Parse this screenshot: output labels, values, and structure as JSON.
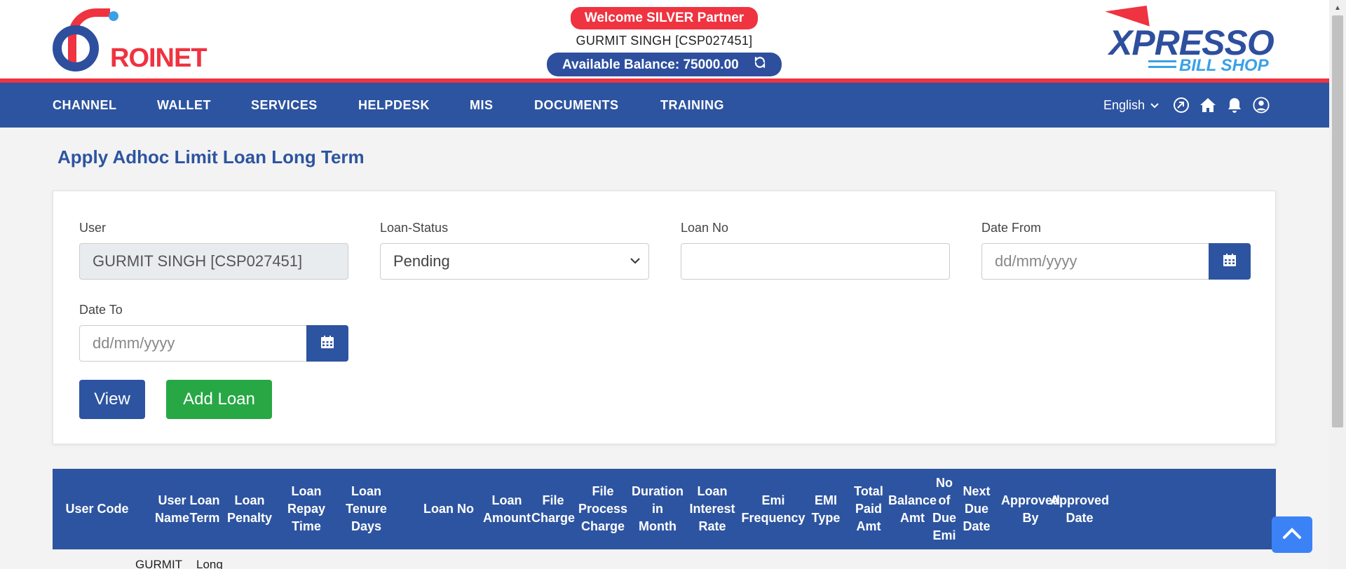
{
  "header": {
    "logo_left": {
      "text_main": "ROINET",
      "text_accent": ""
    },
    "welcome": "Welcome SILVER Partner",
    "user_line": "GURMIT SINGH [CSP027451]",
    "balance": "Available Balance: 75000.00",
    "logo_right": {
      "line1": "XPRESSO",
      "line2": "BILL SHOP"
    }
  },
  "nav": {
    "items": [
      "CHANNEL",
      "WALLET",
      "SERVICES",
      "HELPDESK",
      "MIS",
      "DOCUMENTS",
      "TRAINING"
    ],
    "language": "English",
    "icons": [
      "dashboard-icon",
      "home-icon",
      "bell-icon",
      "user-icon"
    ]
  },
  "page": {
    "title": "Apply Adhoc Limit Loan Long Term"
  },
  "form": {
    "user_label": "User",
    "user_value": "GURMIT SINGH [CSP027451]",
    "status_label": "Loan-Status",
    "status_value": "Pending",
    "loan_no_label": "Loan No",
    "loan_no_value": "",
    "date_from_label": "Date From",
    "date_from_placeholder": "dd/mm/yyyy",
    "date_to_label": "Date To",
    "date_to_placeholder": "dd/mm/yyyy",
    "view_button": "View",
    "add_loan_button": "Add Loan"
  },
  "table": {
    "headers": [
      [
        "User Code"
      ],
      [
        "User",
        "Name"
      ],
      [
        "Loan",
        "Term"
      ],
      [
        "Loan",
        "Penalty"
      ],
      [
        "Loan",
        "Repay",
        "Time"
      ],
      [
        "Loan",
        "Tenure",
        "Days"
      ],
      [
        "Loan No"
      ],
      [
        "Loan",
        "Amount"
      ],
      [
        "File",
        "Charge"
      ],
      [
        "File",
        "Process",
        "Charge"
      ],
      [
        "Duration",
        "in",
        "Month"
      ],
      [
        "Loan",
        "Interest",
        "Rate"
      ],
      [
        "Emi",
        "Frequency"
      ],
      [
        "EMI",
        "Type"
      ],
      [
        "Total",
        "Paid",
        "Amt"
      ],
      [
        "Balance",
        "Amt"
      ],
      [
        "No",
        "of",
        "Due",
        "Emi"
      ],
      [
        "Next",
        "Due",
        "Date"
      ],
      [
        "Approved",
        "By"
      ],
      [
        "Approved",
        "Date"
      ]
    ],
    "first_row": {
      "user_name": "GURMIT",
      "loan_term": "Long"
    }
  },
  "colors": {
    "primary": "#2d54a0",
    "accent_red": "#ef3340",
    "success": "#28a745",
    "to_top": "#3b82f6"
  }
}
